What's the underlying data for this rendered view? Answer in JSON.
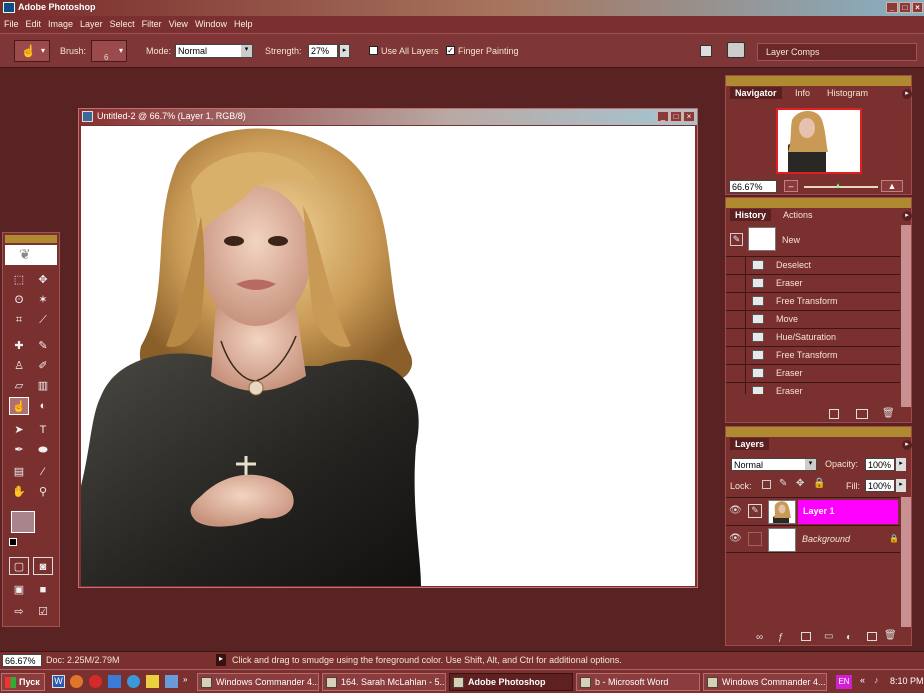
{
  "app": {
    "title": "Adobe Photoshop"
  },
  "menu": [
    "File",
    "Edit",
    "Image",
    "Layer",
    "Select",
    "Filter",
    "View",
    "Window",
    "Help"
  ],
  "options": {
    "brush_label": "Brush:",
    "brush_size": "6",
    "mode_label": "Mode:",
    "mode_value": "Normal",
    "strength_label": "Strength:",
    "strength_value": "27%",
    "use_all_layers": "Use All Layers",
    "finger_painting": "Finger Painting",
    "layer_comps": "Layer Comps"
  },
  "document": {
    "title": "Untitled-2 @ 66.7% (Layer 1, RGB/8)"
  },
  "navigator": {
    "tabs": [
      "Navigator",
      "Info",
      "Histogram"
    ],
    "zoom": "66.67%"
  },
  "history": {
    "tabs": [
      "History",
      "Actions"
    ],
    "snapshot": "New",
    "items": [
      "Deselect",
      "Eraser",
      "Free Transform",
      "Move",
      "Hue/Saturation",
      "Free Transform",
      "Eraser",
      "Eraser"
    ]
  },
  "layers": {
    "tab": "Layers",
    "blend_mode": "Normal",
    "opacity_label": "Opacity:",
    "opacity_value": "100%",
    "lock_label": "Lock:",
    "fill_label": "Fill:",
    "fill_value": "100%",
    "items": [
      {
        "name": "Layer 1",
        "selected": true
      },
      {
        "name": "Background",
        "selected": false
      }
    ]
  },
  "status": {
    "zoom": "66.67%",
    "doc": "Doc: 2.25M/2.79M",
    "hint": "Click and drag to smudge using the foreground color.  Use Shift, Alt, and Ctrl for additional options."
  },
  "taskbar": {
    "start": "Пуск",
    "tasks": [
      "Windows Commander 4....",
      "164. Sarah McLahlan - 5...",
      "Adobe Photoshop",
      "b - Microsoft Word",
      "Windows Commander 4...."
    ],
    "lang": "EN",
    "time": "8:10 PM"
  },
  "colors": {
    "accent": "#ff00ff",
    "panel": "#7b3030",
    "background": "#5a2323",
    "panel_header": "#b08a30"
  }
}
